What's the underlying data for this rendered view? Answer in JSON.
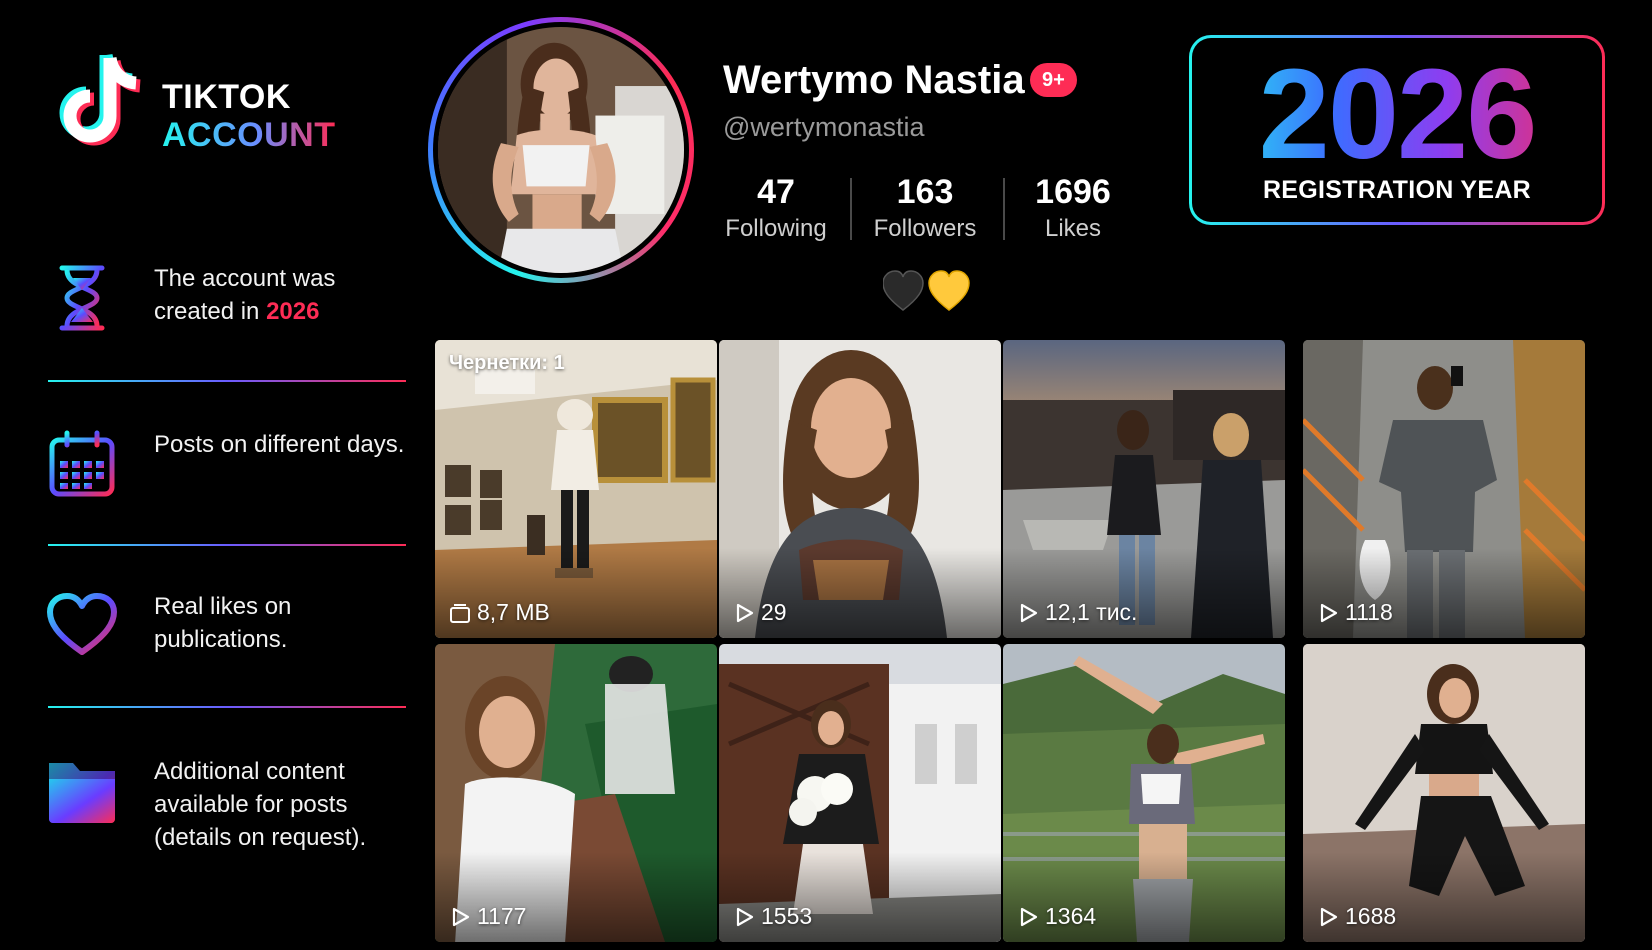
{
  "brand": {
    "line1": "TIKTOK",
    "line2": "ACCOUNT",
    "logo_icon": "tiktok-note-icon"
  },
  "features": [
    {
      "icon": "hourglass-icon",
      "text_before": "The account was created in ",
      "highlight": "2026",
      "text_after": ""
    },
    {
      "icon": "calendar-icon",
      "text_before": "Posts on different days.",
      "highlight": "",
      "text_after": ""
    },
    {
      "icon": "heart-outline-icon",
      "text_before": "Real likes on publications.",
      "highlight": "",
      "text_after": ""
    },
    {
      "icon": "folder-icon",
      "text_before": "Additional content available for posts (details on request).",
      "highlight": "",
      "text_after": ""
    }
  ],
  "profile": {
    "name": "Wertymo Nastia",
    "badge": "9+",
    "handle": "@wertymonastia",
    "stats": [
      {
        "value": "47",
        "label": "Following"
      },
      {
        "value": "163",
        "label": "Followers"
      },
      {
        "value": "1696",
        "label": "Likes"
      }
    ],
    "bio_emoji": [
      "black-heart-icon",
      "yellow-heart-icon"
    ]
  },
  "year_card": {
    "year": "2026",
    "label": "REGISTRATION YEAR"
  },
  "posts": [
    {
      "overlay": "Чернетки: 1",
      "icon": "drafts-stack-icon",
      "stat": "8,7 MB"
    },
    {
      "overlay": "",
      "icon": "play-icon",
      "stat": "29"
    },
    {
      "overlay": "",
      "icon": "play-icon",
      "stat": "12,1 тис."
    },
    {
      "overlay": "",
      "icon": "play-icon",
      "stat": "1118"
    },
    {
      "overlay": "",
      "icon": "play-icon",
      "stat": "1177"
    },
    {
      "overlay": "",
      "icon": "play-icon",
      "stat": "1553"
    },
    {
      "overlay": "",
      "icon": "play-icon",
      "stat": "1364"
    },
    {
      "overlay": "",
      "icon": "play-icon",
      "stat": "1688"
    }
  ],
  "colors": {
    "cyan": "#25f4ee",
    "red": "#fe2c55",
    "background": "#000000"
  }
}
